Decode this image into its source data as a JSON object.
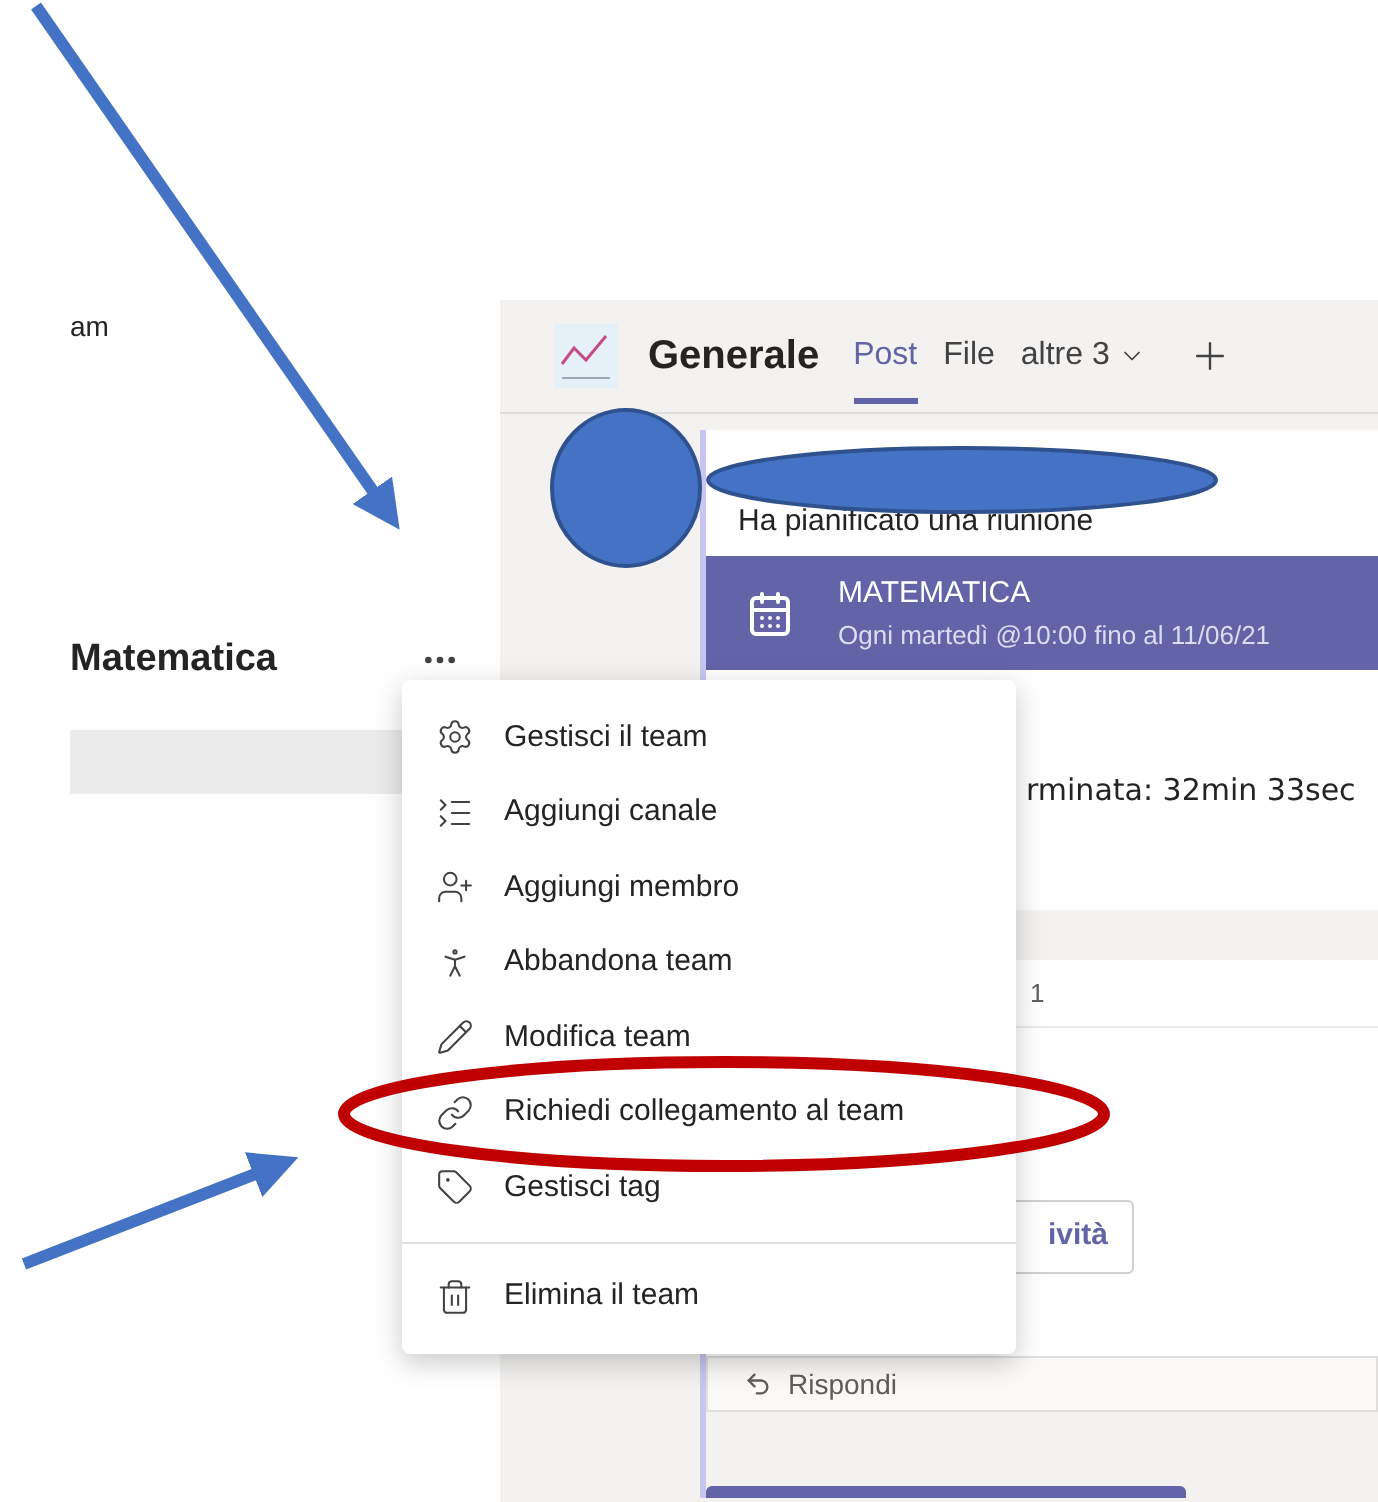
{
  "sidebar": {
    "heading_fragment": "am",
    "team_name": "Matematica"
  },
  "channel_header": {
    "title": "Generale",
    "tabs": [
      {
        "label": "Post",
        "selected": true,
        "kind": "plain"
      },
      {
        "label": "File",
        "selected": false,
        "kind": "plain"
      },
      {
        "label": "altre 3",
        "selected": false,
        "kind": "dropdown"
      }
    ]
  },
  "post": {
    "text": "Ha pianificato una riunione",
    "meeting": {
      "title": "MATEMATICA",
      "schedule": "Ogni martedì @10:00 fino al 11/06/21"
    },
    "ended_text": "rminata: 32min 33sec"
  },
  "second_post": {
    "date_fragment": "1",
    "button": "ività",
    "reply": "Rispondi"
  },
  "menu": {
    "groups": [
      [
        {
          "label": "Gestisci il team"
        },
        {
          "label": "Aggiungi canale"
        },
        {
          "label": "Aggiungi membro"
        },
        {
          "label": "Abbandona team"
        },
        {
          "label": "Modifica team"
        },
        {
          "label": "Richiedi collegamento al team"
        },
        {
          "label": "Gestisci tag"
        }
      ],
      [
        {
          "label": "Elimina il team"
        }
      ]
    ]
  }
}
